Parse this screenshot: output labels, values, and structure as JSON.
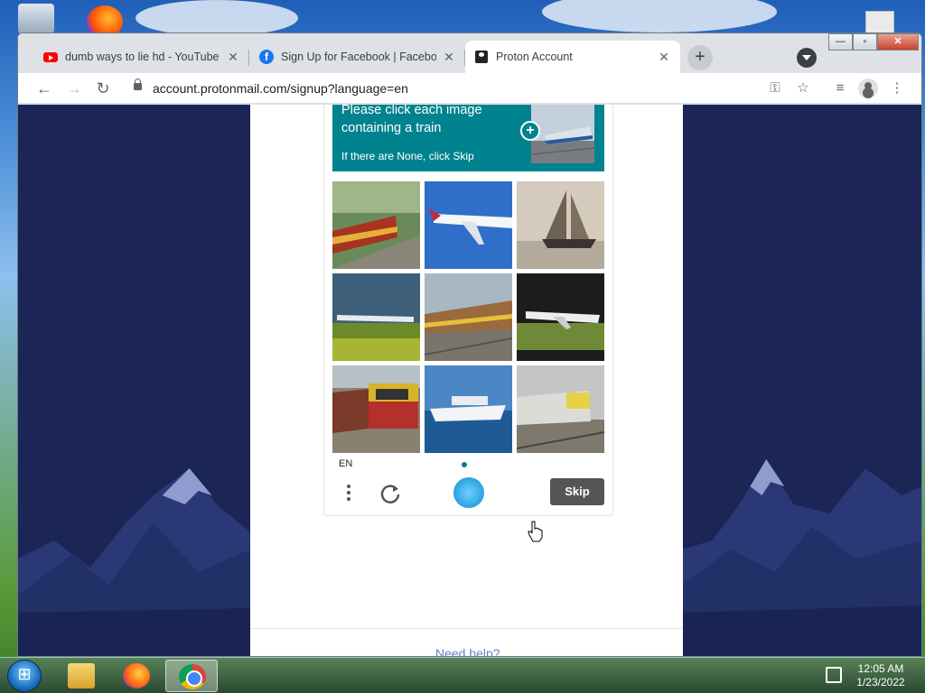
{
  "browser": {
    "tabs": [
      {
        "title": "dumb ways to lie hd - YouTube",
        "favicon": "youtube-icon",
        "active": false
      },
      {
        "title": "Sign Up for Facebook | Facebook",
        "favicon": "facebook-icon",
        "active": false
      },
      {
        "title": "Proton Account",
        "favicon": "proton-icon",
        "active": true
      }
    ],
    "new_tab": "+",
    "tab_close": "✕",
    "window_buttons": {
      "minimize": "—",
      "maximize": "▫",
      "close": "✕"
    },
    "url": "account.protonmail.com/signup?language=en"
  },
  "captcha": {
    "prompt_line1": "Please click each image",
    "prompt_line2": "containing a train",
    "prompt_hint": "If there are None, click Skip",
    "plus_symbol": "+",
    "tiles": [
      "train",
      "airplane",
      "sailboat",
      "airplane",
      "train",
      "airplane",
      "train",
      "cruise-ship",
      "train"
    ],
    "language": "EN",
    "skip_label": "Skip",
    "accent_color": "#00838f"
  },
  "page": {
    "help_link": "Need help?",
    "background_color": "#1b2556"
  },
  "taskbar": {
    "time": "12:05 AM",
    "date": "1/23/2022"
  }
}
